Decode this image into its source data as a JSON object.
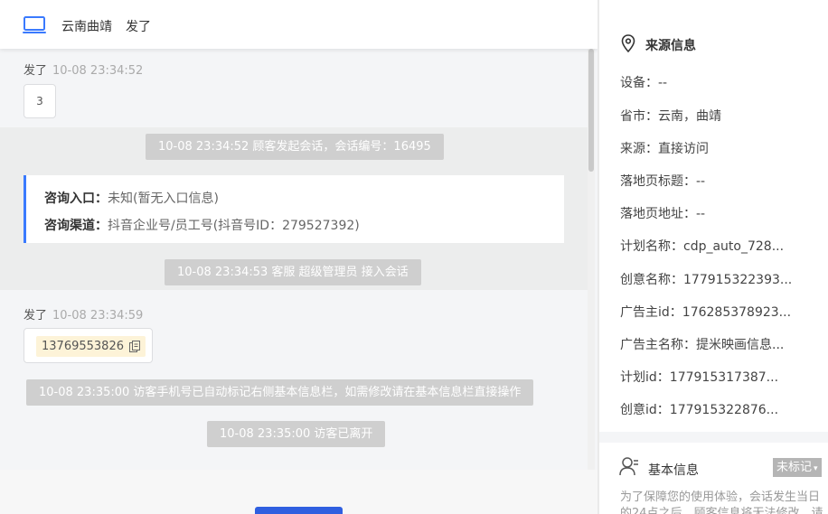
{
  "header": {
    "visitor_location": "云南曲靖",
    "visitor_name": "发了"
  },
  "messages": [
    {
      "sender": "发了",
      "time": "10-08 23:34:52",
      "text": "3"
    },
    {
      "sender": "发了",
      "time": "10-08 23:34:59",
      "phone": "13769553826"
    }
  ],
  "system": {
    "start": "10-08 23:34:52 顾客发起会话，会话编号：16495",
    "join": "10-08 23:34:53 客服 超级管理员 接入会话",
    "auto_mark": "10-08 23:35:00 访客手机号已自动标记右侧基本信息栏，如需修改请在基本信息栏直接操作",
    "left": "10-08 23:35:00 访客已离开"
  },
  "consult_card": {
    "entry_label": "咨询入口：",
    "entry_value": "未知(暂无入口信息)",
    "channel_label": "咨询渠道：",
    "channel_value": "抖音企业号/员工号(抖音号ID：279527392)"
  },
  "source_panel": {
    "title": "来源信息",
    "fields": [
      {
        "label": "设备：",
        "value": "--"
      },
      {
        "label": "省市：",
        "value": "云南，曲靖"
      },
      {
        "label": "来源：",
        "value": "直接访问"
      },
      {
        "label": "落地页标题：",
        "value": "--"
      },
      {
        "label": "落地页地址：",
        "value": "--"
      },
      {
        "label": "计划名称：",
        "value": "cdp_auto_728..."
      },
      {
        "label": "创意名称：",
        "value": "177915322393..."
      },
      {
        "label": "广告主id：",
        "value": "176285378923..."
      },
      {
        "label": "广告主名称：",
        "value": "提米映画信息..."
      },
      {
        "label": "计划id：",
        "value": "177915317387..."
      },
      {
        "label": "创意id：",
        "value": "177915322876..."
      }
    ]
  },
  "basic_panel": {
    "title": "基本信息",
    "tag_label": "未标记",
    "notice": "为了保障您的使用体验，会话发生当日的24点之后，顾客信息将无法修改，请"
  },
  "colors": {
    "accent": "#3a7afe",
    "system_pill": "#cfcfcf",
    "phone_highlight": "#fdf3d8"
  }
}
